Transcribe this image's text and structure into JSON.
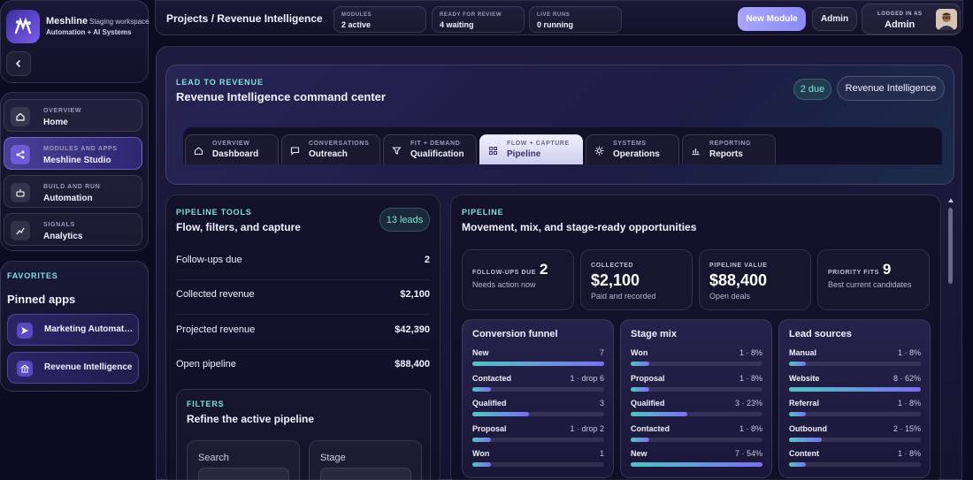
{
  "brand": {
    "name": "Meshline",
    "workspace": "Staging workspace",
    "subtitle": "Automation + AI Systems"
  },
  "nav": [
    {
      "eyebrow": "OVERVIEW",
      "label": "Home",
      "icon": "home-icon"
    },
    {
      "eyebrow": "MODULES AND APPS",
      "label": "Meshline Studio",
      "icon": "share-icon"
    },
    {
      "eyebrow": "BUILD AND RUN",
      "label": "Automation",
      "icon": "robot-icon"
    },
    {
      "eyebrow": "SIGNALS",
      "label": "Analytics",
      "icon": "chart-icon"
    }
  ],
  "favorites": {
    "eyebrow": "FAVORITES",
    "title": "Pinned apps",
    "items": [
      {
        "label": "Marketing Automation",
        "icon": "send-icon"
      },
      {
        "label": "Revenue Intelligence",
        "icon": "bank-icon"
      }
    ]
  },
  "topbar": {
    "breadcrumb": "Projects / Revenue Intelligence",
    "stats": [
      {
        "eyebrow": "MODULES",
        "value": "2 active"
      },
      {
        "eyebrow": "READY FOR REVIEW",
        "value": "4 waiting"
      },
      {
        "eyebrow": "LIVE RUNS",
        "value": "0 running"
      }
    ],
    "new_module": "New Module",
    "admin": "Admin",
    "user_eyebrow": "LOGGED IN AS",
    "user_name": "Admin"
  },
  "hero": {
    "eyebrow": "LEAD TO REVENUE",
    "title": "Revenue Intelligence command center",
    "due_badge": "2 due",
    "module_badge": "Revenue Intelligence"
  },
  "tabs": [
    {
      "eyebrow": "OVERVIEW",
      "label": "Dashboard",
      "icon": "home-icon",
      "active": false
    },
    {
      "eyebrow": "CONVERSATIONS",
      "label": "Outreach",
      "icon": "chat-icon",
      "active": false
    },
    {
      "eyebrow": "FIT + DEMAND",
      "label": "Qualification",
      "icon": "filter-icon",
      "active": false
    },
    {
      "eyebrow": "FLOW + CAPTURE",
      "label": "Pipeline",
      "icon": "grid-icon",
      "active": true
    },
    {
      "eyebrow": "SYSTEMS",
      "label": "Operations",
      "icon": "gear-icon",
      "active": false
    },
    {
      "eyebrow": "REPORTING",
      "label": "Reports",
      "icon": "bar-chart-icon",
      "active": false
    }
  ],
  "tools": {
    "eyebrow": "PIPELINE TOOLS",
    "title": "Flow, filters, and capture",
    "leads_badge": "13 leads",
    "rows": [
      {
        "label": "Follow-ups due",
        "value": "2"
      },
      {
        "label": "Collected revenue",
        "value": "$2,100"
      },
      {
        "label": "Projected revenue",
        "value": "$42,390"
      },
      {
        "label": "Open pipeline",
        "value": "$88,400"
      }
    ],
    "filters": {
      "eyebrow": "FILTERS",
      "title": "Refine the active pipeline",
      "search_label": "Search",
      "stage_label": "Stage"
    }
  },
  "pipeline": {
    "eyebrow": "PIPELINE",
    "title": "Movement, mix, and stage-ready opportunities",
    "kpis": [
      {
        "eyebrow": "FOLLOW-UPS DUE",
        "value": "2",
        "sub": "Needs action now"
      },
      {
        "eyebrow": "COLLECTED",
        "value": "$2,100",
        "sub": "Paid and recorded"
      },
      {
        "eyebrow": "PIPELINE VALUE",
        "value": "$88,400",
        "sub": "Open deals"
      },
      {
        "eyebrow": "PRIORITY FITS",
        "value": "9",
        "sub": "Best current candidates"
      }
    ],
    "cards": [
      {
        "title": "Conversion funnel",
        "bars": [
          {
            "label": "New",
            "value": "7",
            "fill": 1.0
          },
          {
            "label": "Contacted",
            "value": "1 · drop 6",
            "fill": 0.14
          },
          {
            "label": "Qualified",
            "value": "3",
            "fill": 0.43
          },
          {
            "label": "Proposal",
            "value": "1 · drop 2",
            "fill": 0.14
          },
          {
            "label": "Won",
            "value": "1",
            "fill": 0.14
          }
        ]
      },
      {
        "title": "Stage mix",
        "bars": [
          {
            "label": "Won",
            "value": "1 · 8%",
            "fill": 0.14
          },
          {
            "label": "Proposal",
            "value": "1 · 8%",
            "fill": 0.14
          },
          {
            "label": "Qualified",
            "value": "3 · 23%",
            "fill": 0.43
          },
          {
            "label": "Contacted",
            "value": "1 · 8%",
            "fill": 0.14
          },
          {
            "label": "New",
            "value": "7 · 54%",
            "fill": 1.0
          }
        ]
      },
      {
        "title": "Lead sources",
        "bars": [
          {
            "label": "Manual",
            "value": "1 · 8%",
            "fill": 0.13
          },
          {
            "label": "Website",
            "value": "8 · 62%",
            "fill": 1.0
          },
          {
            "label": "Referral",
            "value": "1 · 8%",
            "fill": 0.13
          },
          {
            "label": "Outbound",
            "value": "2 · 15%",
            "fill": 0.25
          },
          {
            "label": "Content",
            "value": "1 · 8%",
            "fill": 0.13
          }
        ]
      }
    ]
  }
}
